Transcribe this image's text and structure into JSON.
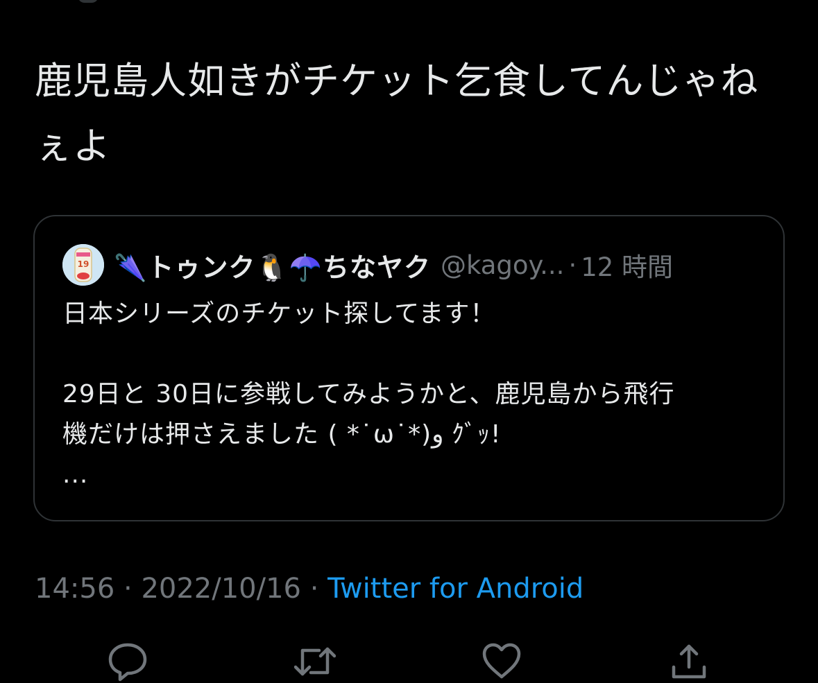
{
  "tweet": {
    "text": "鹿児島人如きがチケット乞食してんじゃねぇよ"
  },
  "quote": {
    "display_name": "🌂トゥンク🐧☂️ちなヤク",
    "handle": "@kagoy...",
    "separator": "·",
    "time": "12 時間",
    "lines": [
      "日本シリーズのチケット探してます！",
      "",
      "29日と 30日に参戦してみようかと、鹿児島から飛行",
      "機だけは押さえました ( *˙ω˙*)و ｸﾞｯ!",
      "..."
    ],
    "avatar_label": "19"
  },
  "meta": {
    "time": "14:56",
    "sep1": " · ",
    "date": "2022/10/16",
    "sep2": " · ",
    "source": "Twitter for Android"
  },
  "actions": {
    "icons": [
      "reply-icon",
      "retweet-icon",
      "like-icon",
      "share-icon"
    ]
  },
  "colors": {
    "background": "#000000",
    "text": "#e7e9ea",
    "secondary": "#71767b",
    "link": "#1d9bf0",
    "border": "#2f3336"
  }
}
